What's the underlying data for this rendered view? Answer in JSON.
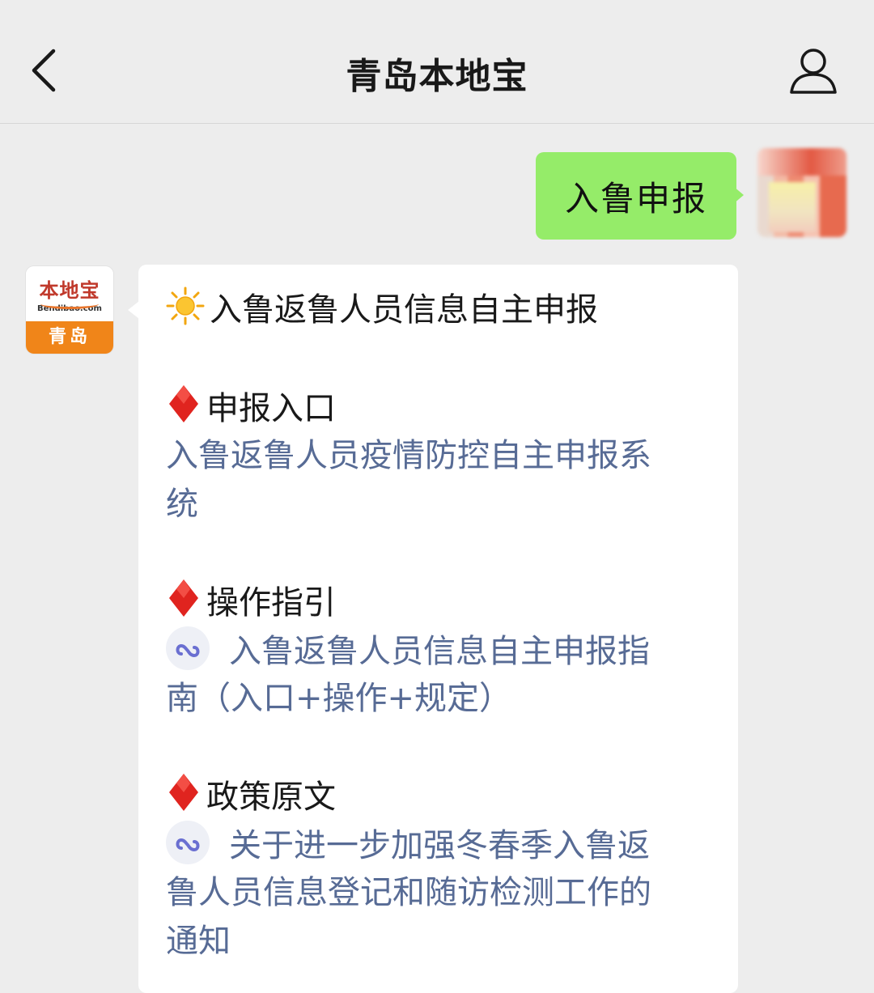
{
  "header": {
    "title": "青岛本地宝",
    "back_icon": "chevron-left-icon",
    "profile_icon": "person-icon"
  },
  "outgoing": {
    "text": "入鲁申报"
  },
  "bot_avatar": {
    "logo_text": "本地宝",
    "logo_sub": "Bendibao.com",
    "city": "青岛"
  },
  "message": {
    "title": "入鲁返鲁人员信息自主申报",
    "sections": [
      {
        "heading": "申报入口",
        "link_lines": [
          "入鲁返鲁人员疫情防控自主申报系",
          "统"
        ]
      },
      {
        "heading": "操作指引",
        "link_lines": [
          "入鲁返鲁人员信息自主申报指",
          "南（入口+操作+规定）"
        ]
      },
      {
        "heading": "政策原文",
        "link_lines": [
          "关于进一步加强冬春季入鲁返",
          "鲁人员信息登记和随访检测工作的",
          "通知"
        ]
      }
    ]
  },
  "colors": {
    "background": "#ededed",
    "outgoing_bubble": "#95ec69",
    "link": "#576b95",
    "diamond": "#e0241f",
    "brand_orange": "#f08519"
  }
}
